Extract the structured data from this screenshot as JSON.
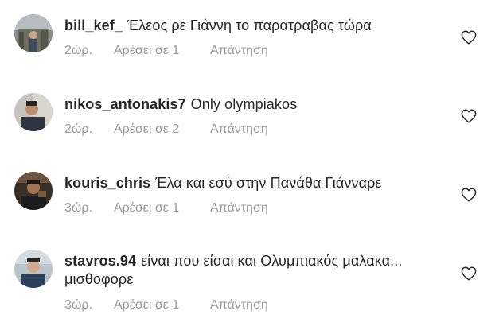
{
  "comments": [
    {
      "username": "bill_kef_",
      "text": "Έλεος ρε Γιάννη το παρατραβας τώρα",
      "time": "2ώρ.",
      "likes": "Αρέσει σε 1",
      "reply": "Απάντηση",
      "avatar_icon": "avatar-photo",
      "like_icon": "heart-outline-icon"
    },
    {
      "username": "nikos_antonakis7",
      "text": "Only olympiakos",
      "time": "2ώρ.",
      "likes": "Αρέσει σε 2",
      "reply": "Απάντηση",
      "avatar_icon": "avatar-photo",
      "like_icon": "heart-outline-icon"
    },
    {
      "username": "kouris_chris",
      "text": "Έλα και εσύ στην Πανάθα Γιάνναρε",
      "time": "3ώρ.",
      "likes": "Αρέσει σε 1",
      "reply": "Απάντηση",
      "avatar_icon": "avatar-photo",
      "like_icon": "heart-outline-icon"
    },
    {
      "username": "stavros.94",
      "text": "είναι που είσαι και Ολυμπιακός μαλακα... μισθοφορε",
      "time": "3ώρ.",
      "likes": "Αρέσει σε 1",
      "reply": "Απάντηση",
      "avatar_icon": "avatar-photo",
      "like_icon": "heart-outline-icon"
    }
  ],
  "colors": {
    "text": "#262626",
    "meta": "#999999",
    "heart": "#262626"
  }
}
